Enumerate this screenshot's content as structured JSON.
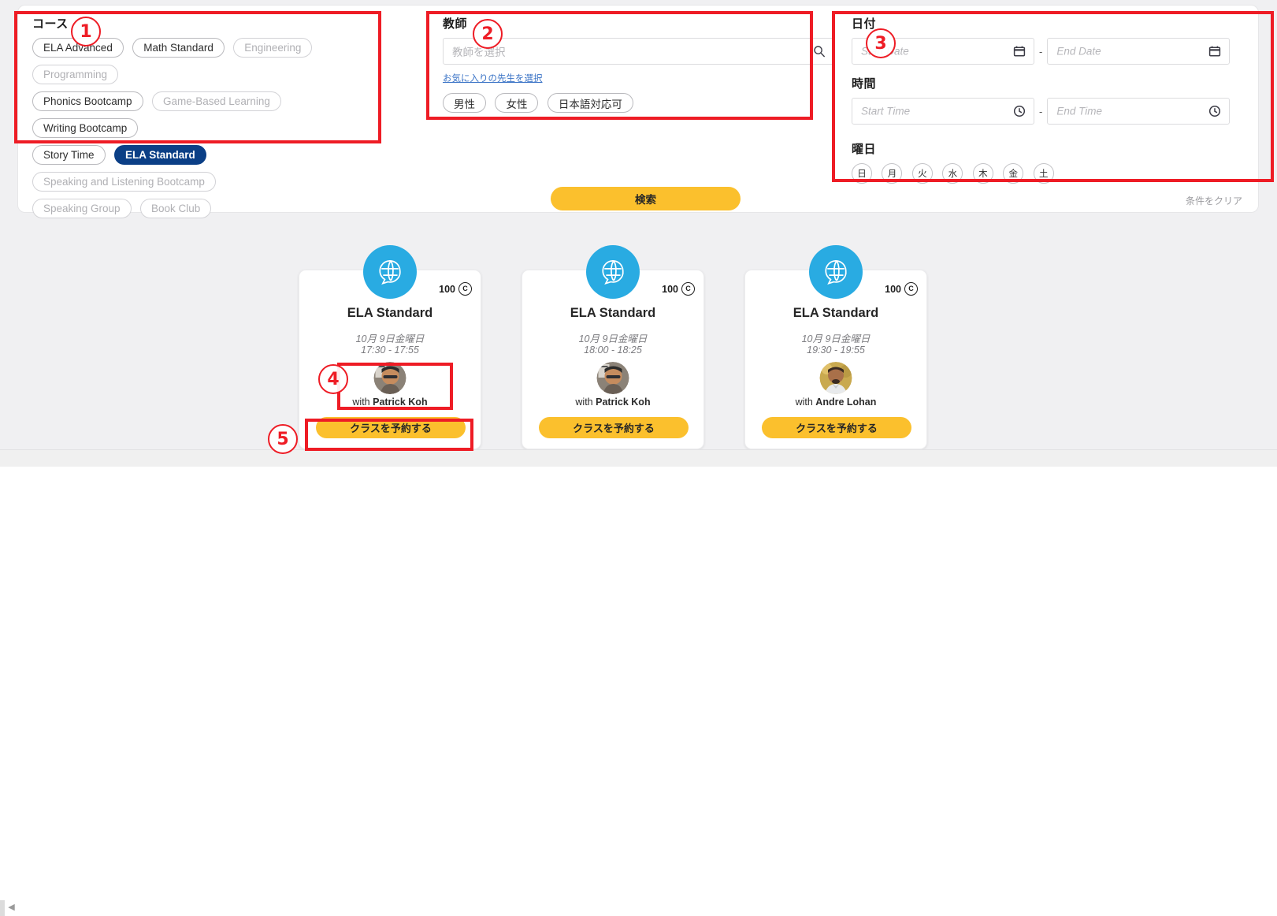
{
  "search_panel": {
    "courses": {
      "title": "コース",
      "chips": [
        {
          "label": "ELA Advanced",
          "state": "normal"
        },
        {
          "label": "Math Standard",
          "state": "normal"
        },
        {
          "label": "Engineering",
          "state": "dim"
        },
        {
          "label": "Programming",
          "state": "dim"
        },
        {
          "label": "Phonics Bootcamp",
          "state": "normal"
        },
        {
          "label": "Game-Based Learning",
          "state": "dim"
        },
        {
          "label": "Writing Bootcamp",
          "state": "normal"
        },
        {
          "label": "Story Time",
          "state": "normal"
        },
        {
          "label": "ELA Standard",
          "state": "selected"
        },
        {
          "label": "Speaking and Listening Bootcamp",
          "state": "dim"
        },
        {
          "label": "Speaking Group",
          "state": "dim"
        },
        {
          "label": "Book Club",
          "state": "dim"
        }
      ]
    },
    "teacher": {
      "title": "教師",
      "input_placeholder": "教師を選択",
      "input_value": "",
      "search_icon": "search-icon",
      "favorite_link": "お気に入りの先生を選択",
      "chips": [
        {
          "label": "男性"
        },
        {
          "label": "女性"
        },
        {
          "label": "日本語対応可"
        }
      ]
    },
    "date": {
      "title": "日付",
      "start_placeholder": "Start Date",
      "end_placeholder": "End Date",
      "separator": "-",
      "icon": "calendar-icon"
    },
    "time": {
      "title": "時間",
      "start_placeholder": "Start Time",
      "end_placeholder": "End Time",
      "separator": "-",
      "icon": "clock-icon"
    },
    "weekday": {
      "title": "曜日",
      "days": [
        "日",
        "月",
        "火",
        "水",
        "木",
        "金",
        "土"
      ]
    },
    "search_button": "検索",
    "clear_link": "条件をクリア"
  },
  "results": {
    "cards": [
      {
        "icon": "globe-speech-icon",
        "credits": "100",
        "credit_symbol": "C",
        "title": "ELA Standard",
        "date": "10月 9日金曜日",
        "time": "17:30 - 17:55",
        "with_prefix": "with ",
        "teacher": "Patrick Koh",
        "book_button": "クラスを予約する"
      },
      {
        "icon": "globe-speech-icon",
        "credits": "100",
        "credit_symbol": "C",
        "title": "ELA Standard",
        "date": "10月 9日金曜日",
        "time": "18:00 - 18:25",
        "with_prefix": "with ",
        "teacher": "Patrick Koh",
        "book_button": "クラスを予約する"
      },
      {
        "icon": "globe-speech-icon",
        "credits": "100",
        "credit_symbol": "C",
        "title": "ELA Standard",
        "date": "10月 9日金曜日",
        "time": "19:30 - 19:55",
        "with_prefix": "with ",
        "teacher": "Andre Lohan",
        "book_button": "クラスを予約する"
      }
    ]
  },
  "annotations": {
    "markers": [
      "1",
      "2",
      "3",
      "4",
      "5"
    ]
  },
  "colors": {
    "accent_yellow": "#fbc02d",
    "selected_blue": "#0b3f86",
    "icon_blue": "#29abe2",
    "annotation_red": "#ee1c25",
    "page_bg": "#f0f0f2"
  }
}
